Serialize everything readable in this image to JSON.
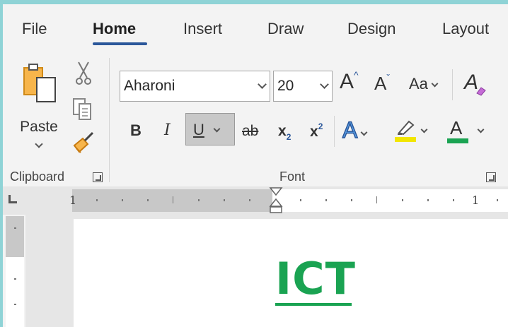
{
  "tabs": [
    {
      "label": "File"
    },
    {
      "label": "Home"
    },
    {
      "label": "Insert"
    },
    {
      "label": "Draw"
    },
    {
      "label": "Design"
    },
    {
      "label": "Layout"
    }
  ],
  "clipboard": {
    "paste_label": "Paste",
    "group_label": "Clipboard"
  },
  "font": {
    "font_name": "Aharoni",
    "font_size": "20",
    "grow_label": "A",
    "shrink_label": "A",
    "case_label": "Aa",
    "clear_label": "A",
    "bold_label": "B",
    "italic_label": "I",
    "underline_label": "U",
    "strike_label": "ab",
    "subscript_base": "x",
    "subscript_mark": "2",
    "superscript_base": "x",
    "superscript_mark": "2",
    "effects_label": "A",
    "font_color_label": "A",
    "group_label": "Font"
  },
  "colors": {
    "highlight": "#f2e600",
    "font_color": "#1aa352",
    "accent": "#2b579a",
    "title_color": "#1aa352"
  },
  "ruler": {
    "left_number": "1",
    "right_number": "1"
  },
  "document": {
    "title": "ICT"
  }
}
